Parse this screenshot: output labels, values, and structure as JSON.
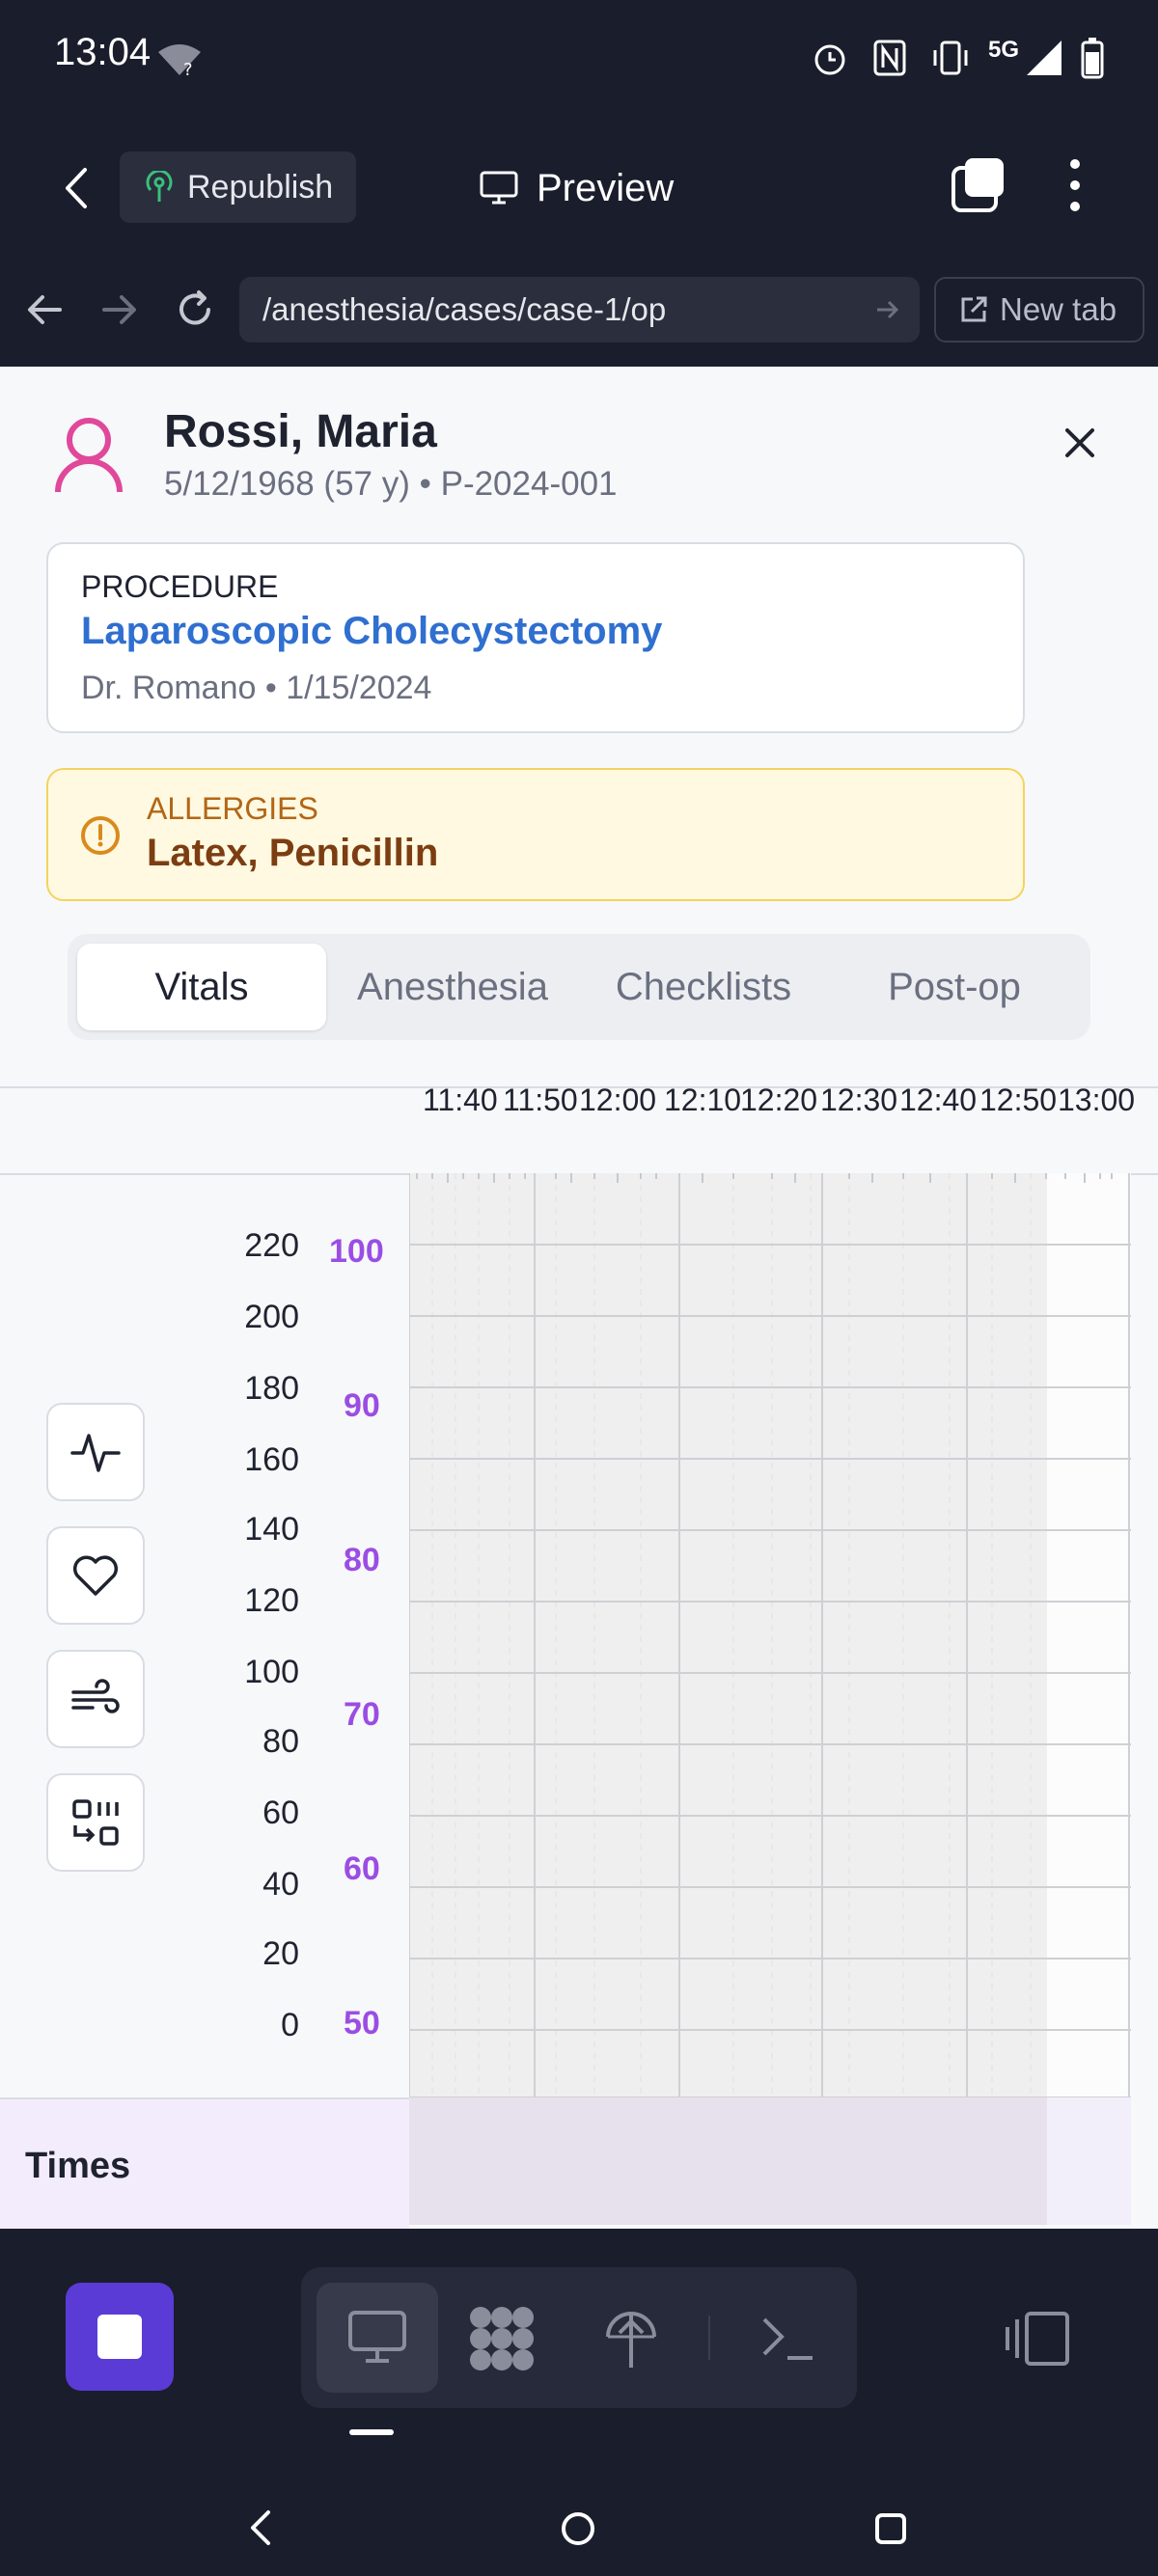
{
  "status_bar": {
    "time": "13:04",
    "network": "5G"
  },
  "app_header": {
    "republish_label": "Republish",
    "preview_label": "Preview"
  },
  "url_bar": {
    "path": "/anesthesia/cases/case-1/op",
    "new_tab_label": "New tab"
  },
  "patient": {
    "name": "Rossi, Maria",
    "details": "5/12/1968 (57 y) • P-2024-001"
  },
  "procedure": {
    "heading": "PROCEDURE",
    "name": "Laparoscopic Cholecystectomy",
    "details": "Dr. Romano • 1/15/2024"
  },
  "allergies": {
    "heading": "ALLERGIES",
    "value": "Latex, Penicillin"
  },
  "tabs": [
    {
      "label": "Vitals",
      "active": true
    },
    {
      "label": "Anesthesia",
      "active": false
    },
    {
      "label": "Checklists",
      "active": false
    },
    {
      "label": "Post-op",
      "active": false
    }
  ],
  "timeline": {
    "times": [
      "11:40",
      "11:50",
      "12:00",
      "12:10",
      "12:20",
      "12:30",
      "12:40",
      "12:50",
      "13:00"
    ],
    "y_left": [
      "220",
      "200",
      "180",
      "160",
      "140",
      "120",
      "100",
      "80",
      "60",
      "40",
      "20",
      "0"
    ],
    "y_right": [
      "100",
      "90",
      "80",
      "70",
      "60",
      "50"
    ]
  },
  "times_section_label": "Times",
  "colors": {
    "accent": "#5a3bd6",
    "allergy_bg": "#fef9e0",
    "allergy_border": "#f4d35e",
    "link_blue": "#2f6fd0",
    "purple_axis": "#9b4de3",
    "patient_icon": "#e0489a"
  }
}
